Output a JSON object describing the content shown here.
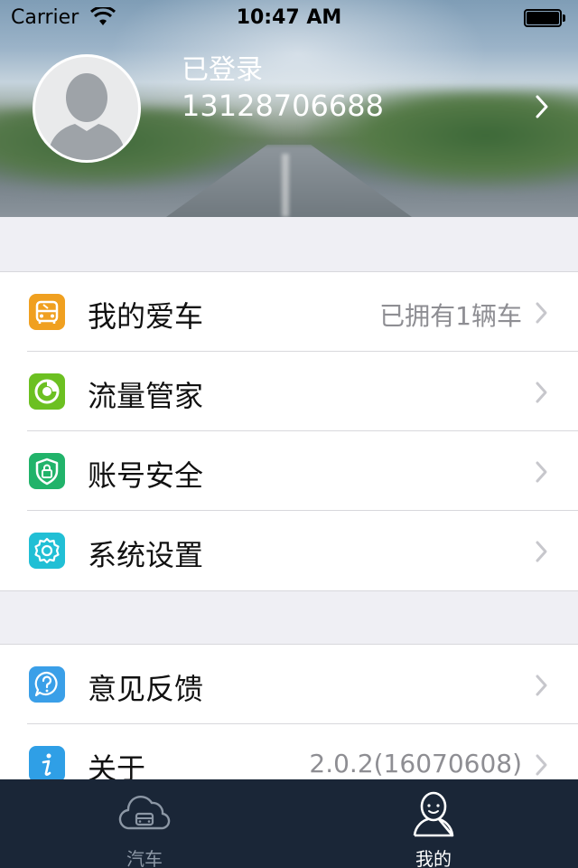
{
  "status_bar": {
    "carrier": "Carrier",
    "time": "10:47 AM"
  },
  "profile": {
    "login_status": "已登录",
    "phone": "13128706688"
  },
  "menu_group_1": [
    {
      "label": "我的爱车",
      "detail": "已拥有1辆车",
      "icon": "car-icon",
      "color": "#f0a020"
    },
    {
      "label": "流量管家",
      "detail": "",
      "icon": "traffic-ring-icon",
      "color": "#6cc021"
    },
    {
      "label": "账号安全",
      "detail": "",
      "icon": "shield-lock-icon",
      "color": "#21b36a"
    },
    {
      "label": "系统设置",
      "detail": "",
      "icon": "gear-icon",
      "color": "#21bfd5"
    }
  ],
  "menu_group_2": [
    {
      "label": "意见反馈",
      "detail": "",
      "icon": "question-bubble-icon",
      "color": "#3a9fe8"
    },
    {
      "label": "关于",
      "detail": "2.0.2(16070608)",
      "icon": "info-icon",
      "color": "#2f9fe6"
    }
  ],
  "tabbar": {
    "tabs": [
      {
        "label": "汽车",
        "icon": "car-cloud-icon",
        "active": false
      },
      {
        "label": "我的",
        "icon": "person-icon",
        "active": true
      }
    ],
    "colors": {
      "background": "#1a2637",
      "active": "#ffffff",
      "inactive": "#8c97a5"
    }
  }
}
